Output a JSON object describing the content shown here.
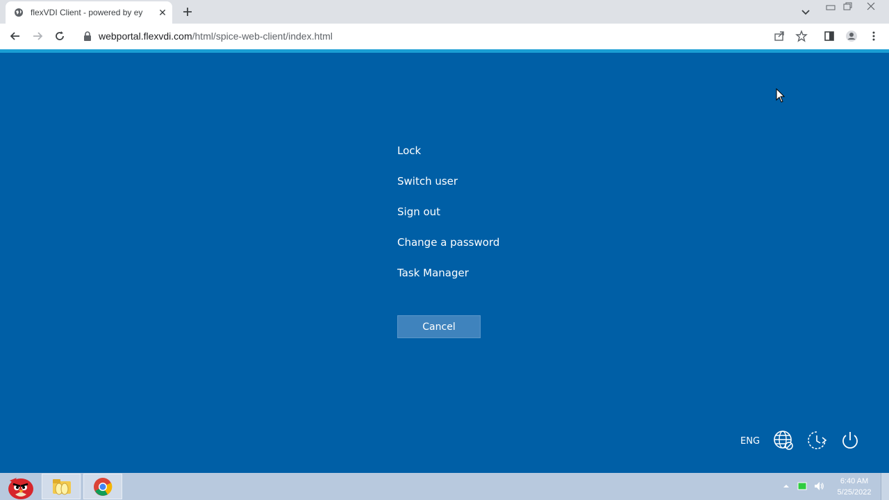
{
  "browser": {
    "tab_title": "flexVDI Client - powered by ey",
    "url_host": "webportal.flexvdi.com",
    "url_path": "/html/spice-web-client/index.html"
  },
  "security_options": {
    "items": [
      "Lock",
      "Switch user",
      "Sign out",
      "Change a password",
      "Task Manager"
    ],
    "cancel_label": "Cancel"
  },
  "system_bar": {
    "language": "ENG",
    "icons": [
      "network-icon",
      "accessibility-icon",
      "power-icon"
    ]
  },
  "taskbar": {
    "apps": [
      "angry-birds-icon",
      "file-explorer-icon",
      "chrome-icon"
    ],
    "time": "6:40 AM",
    "date": "5/25/2022"
  },
  "colors": {
    "desktop_bg": "#005fa6",
    "cancel_bg": "#3f83bd",
    "progress": "#1a9ed4"
  }
}
